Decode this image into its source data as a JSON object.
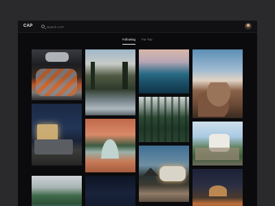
{
  "app": {
    "logo": "CAP",
    "search": {
      "placeholder": "Search CAP"
    }
  },
  "tabs": [
    {
      "label": "Following",
      "active": true
    },
    {
      "label": "For You",
      "active": false
    }
  ],
  "colors": {
    "page_bg": "#2a2a2c",
    "app_bg": "#0b0b0d",
    "text_primary": "#f4f4f4",
    "text_muted": "#8e8e92"
  },
  "feed": {
    "photos": [
      {
        "subject": "sleeping bag in car"
      },
      {
        "subject": "forest river and granite cliff"
      },
      {
        "subject": "ocean waves at dusk"
      },
      {
        "subject": "person on rocky cliffs"
      },
      {
        "subject": "lit rooftop tent at night"
      },
      {
        "subject": "tent view of forest"
      },
      {
        "subject": "pine forest with stream"
      },
      {
        "subject": "meadow camp scene"
      },
      {
        "subject": "mountain lake"
      },
      {
        "subject": "starry night sky"
      },
      {
        "subject": "airstream trailer at dusk"
      },
      {
        "subject": "campfire at night"
      }
    ]
  }
}
